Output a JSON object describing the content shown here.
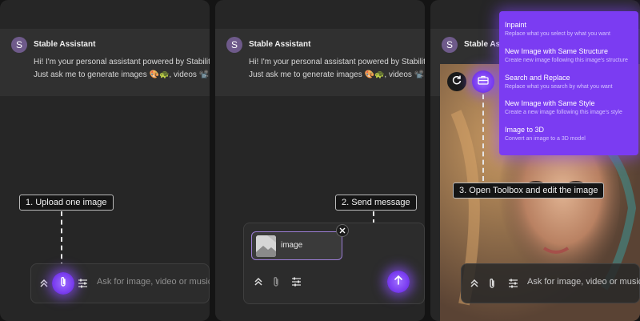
{
  "colors": {
    "accent": "#7b3cf2",
    "panel": "#262626",
    "header": "#303030"
  },
  "assistant": {
    "avatar_letter": "S",
    "name": "Stable Assistant",
    "message_line1": "Hi! I'm your personal assistant powered by Stability AI's te",
    "message_line2": "Just ask me to generate images 🎨🐢, videos 📽️🎬, 🎵 mu"
  },
  "steps": {
    "step1": "1. Upload one image",
    "step2": "2. Send message",
    "step3": "3. Open Toolbox and edit the image"
  },
  "composer": {
    "placeholder": "Ask for image, video or music!"
  },
  "attachment": {
    "label": "image"
  },
  "icons": {
    "collapse": "double-chevron-up-icon",
    "attach": "paperclip-icon",
    "settings": "sliders-icon",
    "send": "arrow-up-icon",
    "refresh": "refresh-icon",
    "toolbox": "toolbox-icon",
    "close": "close-icon",
    "image": "image-placeholder-icon"
  },
  "toolbox_menu": {
    "items": [
      {
        "title": "Inpaint",
        "desc": "Replace what you select by what you want"
      },
      {
        "title": "New Image with Same Structure",
        "desc": "Create new image following this image's structure"
      },
      {
        "title": "Search and Replace",
        "desc": "Replace what you search by what you want"
      },
      {
        "title": "New Image with Same Style",
        "desc": "Create a new image following this image's style"
      },
      {
        "title": "Image to 3D",
        "desc": "Convert an image to a 3D model"
      }
    ]
  }
}
